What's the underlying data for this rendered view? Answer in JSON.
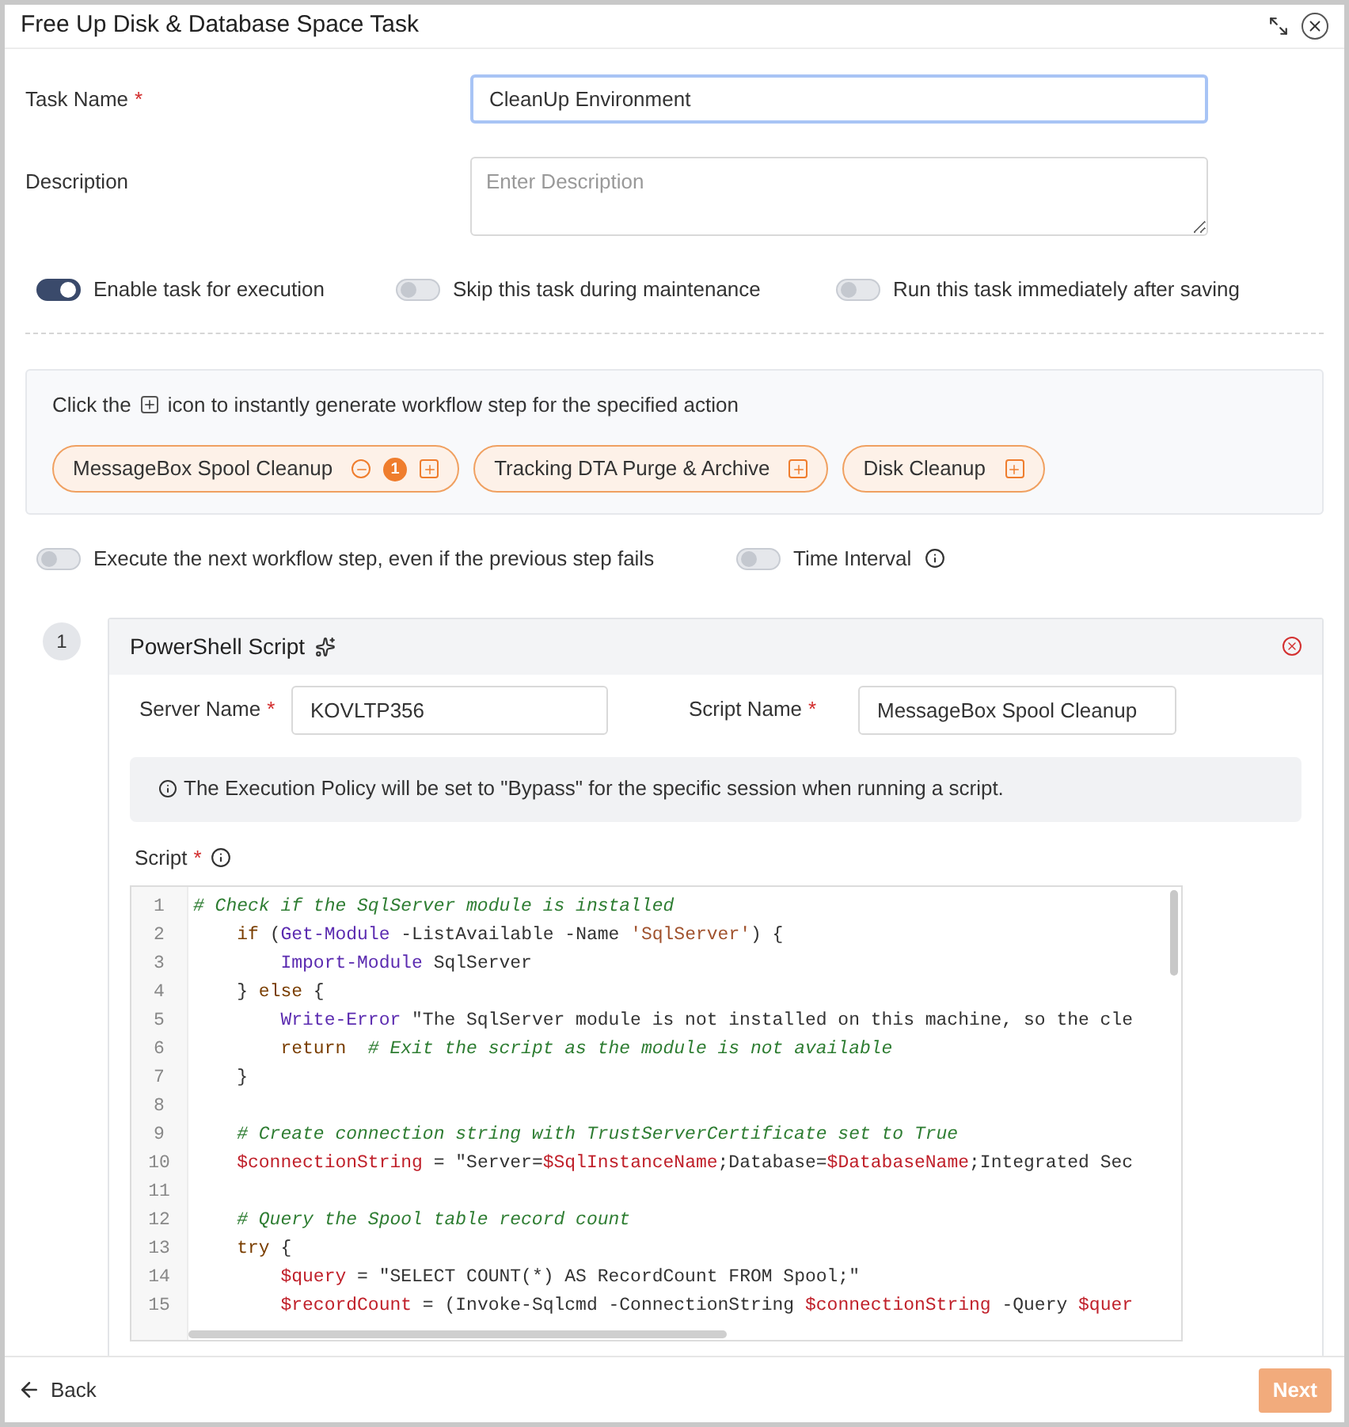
{
  "window": {
    "title": "Free Up Disk & Database Space Task"
  },
  "task_name": {
    "label": "Task Name",
    "required_mark": "*",
    "value": "CleanUp Environment"
  },
  "description": {
    "label": "Description",
    "placeholder": "Enter Description"
  },
  "toggles": [
    {
      "label": "Enable task for execution",
      "on": true
    },
    {
      "label": "Skip this task during maintenance",
      "on": false
    },
    {
      "label": "Run this task immediately after saving",
      "on": false
    }
  ],
  "actions": {
    "hint_before": "Click the",
    "hint_after": "icon to instantly generate workflow step for the specified action",
    "chips": [
      {
        "label": "MessageBox Spool Cleanup",
        "removable": true,
        "count": "1"
      },
      {
        "label": "Tracking DTA Purge & Archive",
        "removable": false
      },
      {
        "label": "Disk Cleanup",
        "removable": false
      }
    ]
  },
  "options": [
    {
      "label": "Execute the next workflow step, even if the previous step fails",
      "on": false
    },
    {
      "label": "Time Interval",
      "on": false,
      "info": true
    }
  ],
  "step": {
    "number": "1",
    "title": "PowerShell Script",
    "server_name": {
      "label": "Server Name",
      "required_mark": "*",
      "value": "KOVLTP356"
    },
    "script_name": {
      "label": "Script Name",
      "required_mark": "*",
      "value": "MessageBox Spool Cleanup"
    },
    "notice": "The Execution Policy will be set to \"Bypass\" for the specific session when running a script.",
    "script": {
      "label": "Script",
      "required_mark": "*",
      "lines": [
        {
          "number": "1",
          "tokens": [
            {
              "kind": "comment",
              "text": "# Check if the SqlServer module is installed"
            }
          ]
        },
        {
          "number": "2",
          "tokens": [
            {
              "kind": "keyword",
              "text": "    if"
            },
            {
              "kind": "plain",
              "text": " ("
            },
            {
              "kind": "cmdlet",
              "text": "Get-Module"
            },
            {
              "kind": "plain",
              "text": " -ListAvailable -Name "
            },
            {
              "kind": "string",
              "text": "'SqlServer'"
            },
            {
              "kind": "plain",
              "text": ") {"
            }
          ]
        },
        {
          "number": "3",
          "tokens": [
            {
              "kind": "cmdlet",
              "text": "        Import-Module"
            },
            {
              "kind": "plain",
              "text": " SqlServer"
            }
          ]
        },
        {
          "number": "4",
          "tokens": [
            {
              "kind": "plain",
              "text": "    } "
            },
            {
              "kind": "keyword",
              "text": "else"
            },
            {
              "kind": "plain",
              "text": " {"
            }
          ]
        },
        {
          "number": "5",
          "tokens": [
            {
              "kind": "cmdlet",
              "text": "        Write-Error"
            },
            {
              "kind": "plain",
              "text": " \"The SqlServer module is not installed on this machine, so the cle"
            }
          ]
        },
        {
          "number": "6",
          "tokens": [
            {
              "kind": "keyword",
              "text": "        return"
            },
            {
              "kind": "comment",
              "text": "  # Exit the script as the module is not available"
            }
          ]
        },
        {
          "number": "7",
          "tokens": [
            {
              "kind": "plain",
              "text": "    }"
            }
          ]
        },
        {
          "number": "8"
        },
        {
          "number": "9",
          "tokens": [
            {
              "kind": "comment",
              "text": "    # Create connection string with TrustServerCertificate set to True"
            }
          ]
        },
        {
          "number": "10",
          "tokens": [
            {
              "kind": "variable",
              "text": "    $connectionString"
            },
            {
              "kind": "plain",
              "text": " = \"Server="
            },
            {
              "kind": "variable",
              "text": "$SqlInstanceName"
            },
            {
              "kind": "plain",
              "text": ";Database="
            },
            {
              "kind": "variable",
              "text": "$DatabaseName"
            },
            {
              "kind": "plain",
              "text": ";Integrated Sec"
            }
          ]
        },
        {
          "number": "11"
        },
        {
          "number": "12",
          "tokens": [
            {
              "kind": "comment",
              "text": "    # Query the Spool table record count"
            }
          ]
        },
        {
          "number": "13",
          "tokens": [
            {
              "kind": "keyword",
              "text": "    try"
            },
            {
              "kind": "plain",
              "text": " {"
            }
          ]
        },
        {
          "number": "14",
          "tokens": [
            {
              "kind": "variable",
              "text": "        $query"
            },
            {
              "kind": "plain",
              "text": " = \"SELECT COUNT(*) AS RecordCount FROM Spool;\""
            }
          ]
        },
        {
          "number": "15",
          "tokens": [
            {
              "kind": "variable",
              "text": "        $recordCount"
            },
            {
              "kind": "plain",
              "text": " = (Invoke-Sqlcmd -ConnectionString "
            },
            {
              "kind": "variable",
              "text": "$connectionString"
            },
            {
              "kind": "plain",
              "text": " -Query "
            },
            {
              "kind": "variable",
              "text": "$quer"
            }
          ]
        }
      ]
    }
  },
  "footer": {
    "back": "Back",
    "next": "Next",
    "next_disabled": true
  }
}
